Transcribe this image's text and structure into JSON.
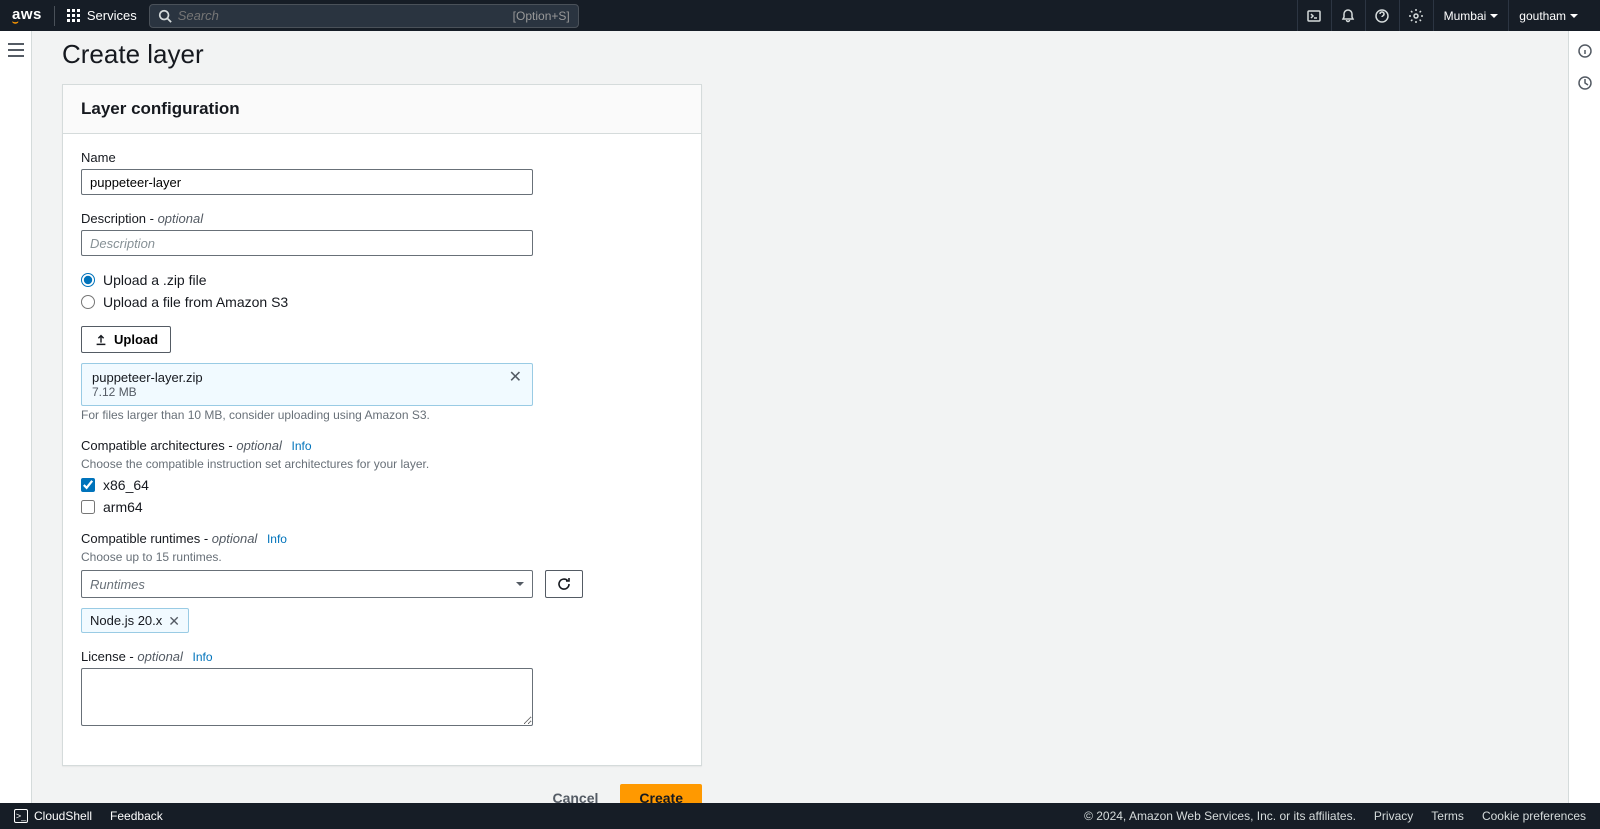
{
  "nav": {
    "services_label": "Services",
    "search_placeholder": "Search",
    "search_shortcut": "[Option+S]",
    "region": "Mumbai",
    "user": "goutham"
  },
  "page": {
    "title": "Create layer"
  },
  "panel": {
    "title": "Layer configuration",
    "name_label": "Name",
    "name_value": "puppeteer-layer",
    "description_label": "Description - ",
    "optional": "optional",
    "description_placeholder": "Description",
    "upload_zip_label": "Upload a .zip file",
    "upload_s3_label": "Upload a file from Amazon S3",
    "upload_button": "Upload",
    "file_name": "puppeteer-layer.zip",
    "file_size": "7.12 MB",
    "file_hint": "For files larger than 10 MB, consider uploading using Amazon S3.",
    "arch_label": "Compatible architectures - ",
    "arch_hint": "Choose the compatible instruction set architectures for your layer.",
    "arch_x86": "x86_64",
    "arch_arm": "arm64",
    "runtimes_label": "Compatible runtimes - ",
    "runtimes_hint": "Choose up to 15 runtimes.",
    "runtimes_placeholder": "Runtimes",
    "runtime_token": "Node.js 20.x",
    "license_label": "License - ",
    "info_link": "Info"
  },
  "actions": {
    "cancel": "Cancel",
    "create": "Create"
  },
  "footer": {
    "cloudshell": "CloudShell",
    "feedback": "Feedback",
    "copyright": "© 2024, Amazon Web Services, Inc. or its affiliates.",
    "privacy": "Privacy",
    "terms": "Terms",
    "cookies": "Cookie preferences"
  }
}
